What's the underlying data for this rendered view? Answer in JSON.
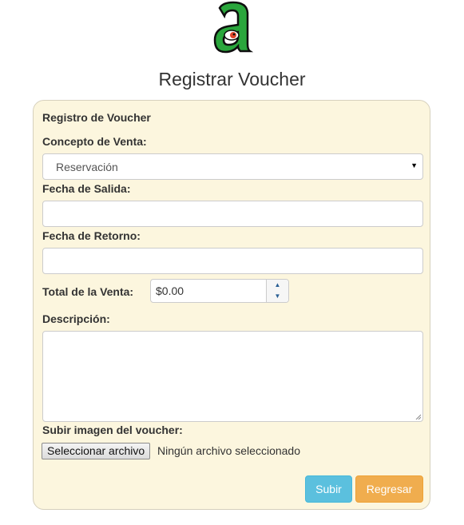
{
  "header": {
    "title": "Registrar Voucher",
    "logo_icon": "letter-a-eye-logo",
    "logo_color": "#2aa63c"
  },
  "form": {
    "heading": "Registro de Voucher",
    "concepto_label": "Concepto de Venta:",
    "concepto_value": "Reservación",
    "fecha_salida_label": "Fecha de Salida:",
    "fecha_salida_value": "",
    "fecha_retorno_label": "Fecha de Retorno:",
    "fecha_retorno_value": "",
    "total_label": "Total de la Venta:",
    "total_value": "$0.00",
    "descripcion_label": "Descripción:",
    "descripcion_value": "",
    "imagen_label": "Subir imagen del voucher:",
    "file_button_label": "Seleccionar archivo",
    "file_status": "Ningún archivo seleccionado",
    "submit_label": "Subir",
    "back_label": "Regresar"
  },
  "colors": {
    "panel_bg": "#fcf6de",
    "submit": "#5bc0de",
    "back": "#f0ad4e"
  }
}
